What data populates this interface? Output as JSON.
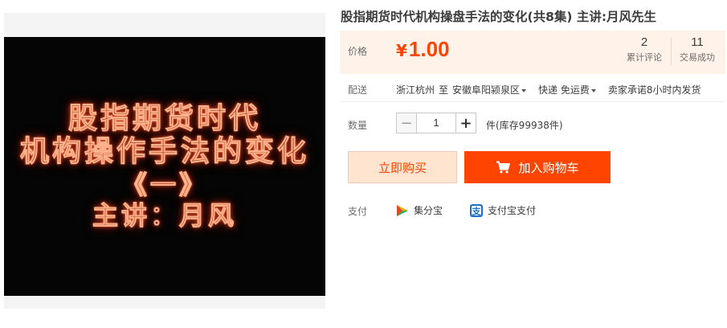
{
  "product": {
    "title": "股指期货时代机构操盘手法的变化(共8集) 主讲:月风先生"
  },
  "video": {
    "lines": [
      "股指期货时代",
      "机构操作手法的变化",
      "《一》",
      "主讲：月风"
    ]
  },
  "price": {
    "label": "价格",
    "currency": "¥",
    "value": "1.00",
    "color": "#ff4400"
  },
  "stats": {
    "reviews_count": "2",
    "reviews_label": "累计评论",
    "sales_count": "11",
    "sales_label": "交易成功"
  },
  "shipping": {
    "label": "配送",
    "origin": "浙江杭州",
    "to": "至",
    "destination": "安徽阜阳颍泉区",
    "method": "快递 免运费",
    "promise": "卖家承诺8小时内发货"
  },
  "quantity": {
    "label": "数量",
    "minus": "−",
    "value": "1",
    "plus": "+",
    "stock": "件(库存99938件)"
  },
  "actions": {
    "buy_now": "立即购买",
    "add_to_cart": "加入购物车"
  },
  "payment": {
    "label": "支付",
    "methods": [
      {
        "name": "集分宝",
        "icon": "jifenbao-icon"
      },
      {
        "name": "支付宝支付",
        "icon": "alipay-icon"
      }
    ]
  }
}
